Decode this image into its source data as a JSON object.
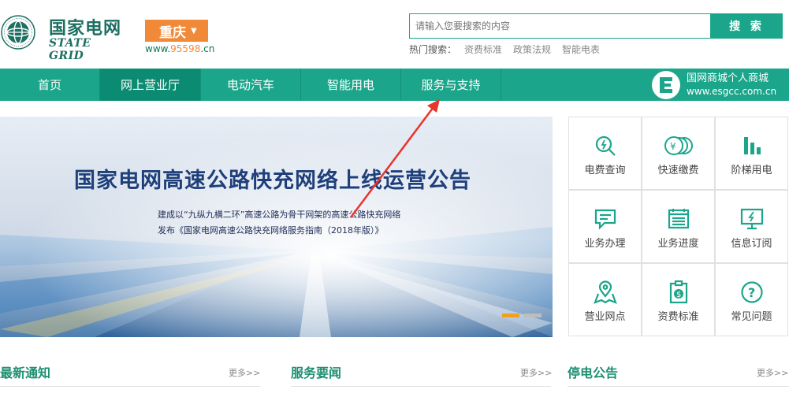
{
  "header": {
    "logo_cn": "国家电网",
    "logo_en": "STATE GRID",
    "city": "重庆",
    "url_prefix": "www.",
    "url_highlight": "95598",
    "url_suffix": ".cn"
  },
  "search": {
    "placeholder": "请输入您要搜索的内容",
    "button": "搜 索",
    "hot_label": "热门搜索：",
    "hot_items": [
      "资费标准",
      "政策法规",
      "智能电表"
    ]
  },
  "nav": {
    "items": [
      "首页",
      "网上营业厅",
      "电动汽车",
      "智能用电",
      "服务与支持"
    ],
    "active_index": 1,
    "shop_title": "国网商城个人商城",
    "shop_url": "www.esgcc.com.cn"
  },
  "banner": {
    "title": "国家电网高速公路快充网络上线运营公告",
    "line1": "建成以“九纵九横二环”高速公路为骨干网架的高速公路快充网络",
    "line2": "发布《国家电网高速公路快充网络服务指南（2018年版）》",
    "slide_count": 2,
    "active_slide": 0
  },
  "services": [
    {
      "label": "电费查询",
      "icon": "bill-search-icon"
    },
    {
      "label": "快速缴费",
      "icon": "coin-payment-icon"
    },
    {
      "label": "阶梯用电",
      "icon": "bar-chart-icon"
    },
    {
      "label": "业务办理",
      "icon": "message-form-icon"
    },
    {
      "label": "业务进度",
      "icon": "progress-clipboard-icon"
    },
    {
      "label": "信息订阅",
      "icon": "monitor-bolt-icon"
    },
    {
      "label": "营业网点",
      "icon": "map-pin-icon"
    },
    {
      "label": "资费标准",
      "icon": "price-tag-icon"
    },
    {
      "label": "常见问题",
      "icon": "question-circle-icon"
    }
  ],
  "news": [
    {
      "title": "最新通知",
      "more": "更多>>"
    },
    {
      "title": "服务要闻",
      "more": "更多>>"
    },
    {
      "title": "停电公告",
      "more": "更多>>"
    }
  ],
  "colors": {
    "primary": "#1ba58a",
    "nav_active": "#0b8c72",
    "accent_orange": "#f18a38",
    "title_blue": "#1f3f7a"
  }
}
